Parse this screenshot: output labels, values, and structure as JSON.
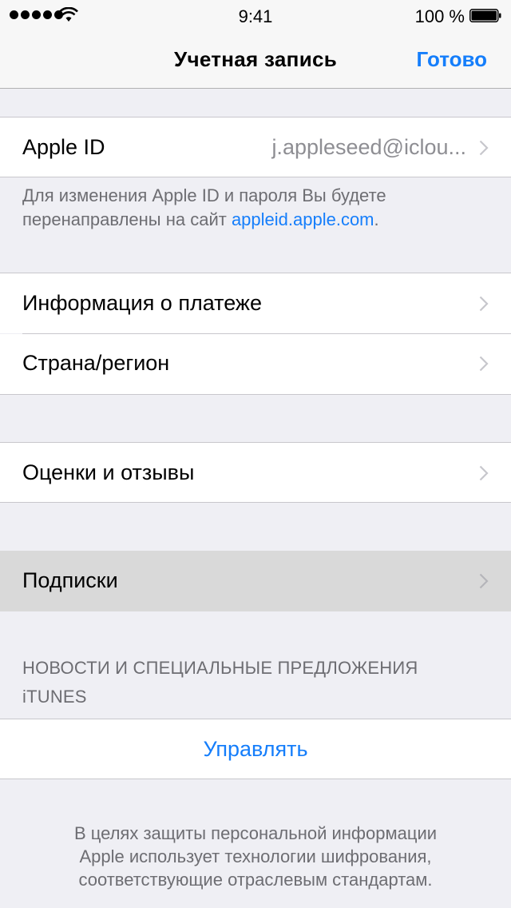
{
  "status_bar": {
    "time": "9:41",
    "battery_percent": "100 %",
    "battery_level": 1.0,
    "signal_bars": 5,
    "icons": [
      "signal-dots-icon",
      "wifi-icon",
      "battery-icon"
    ]
  },
  "nav": {
    "title": "Учетная запись",
    "done_label": "Готово"
  },
  "colors": {
    "accent": "#157efb",
    "background": "#efeff4",
    "secondary_text": "#8e8e93",
    "footer_text": "#6d6d72",
    "highlight": "#d9d9d9"
  },
  "apple_id": {
    "label": "Apple ID",
    "value": "j.appleseed@iclou..."
  },
  "apple_id_footer": {
    "text": "Для изменения Apple ID и пароля Вы будете перенаправлены на сайт ",
    "link": "appleid.apple.com",
    "suffix": "."
  },
  "group2": {
    "items": [
      {
        "label": "Информация о платеже"
      },
      {
        "label": "Страна/регион"
      }
    ]
  },
  "group3": {
    "items": [
      {
        "label": "Оценки и отзывы"
      }
    ]
  },
  "group4": {
    "items": [
      {
        "label": "Подписки",
        "highlighted": true
      }
    ]
  },
  "newsletter": {
    "header_line1": "НОВОСТИ И СПЕЦИАЛЬНЫЕ ПРЕДЛОЖЕНИЯ",
    "header_line2": "iTUNES",
    "manage_label": "Управлять"
  },
  "privacy_note": {
    "line1": "В целях защиты персональной информации",
    "line2": "Apple использует технологии шифрования,",
    "line3": "соответствующие отраслевым стандартам."
  }
}
